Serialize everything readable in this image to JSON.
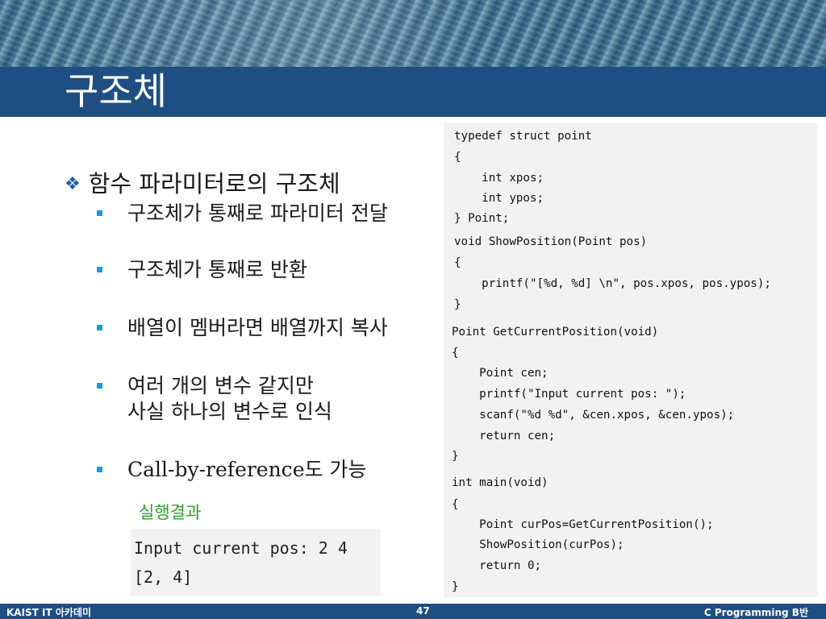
{
  "slide": {
    "title": "구조체",
    "heading": "함수 파라미터로의 구조체",
    "heading_bullet_icon": "diamond-cluster-icon",
    "bullets": [
      "구조체가 통째로 파라미터 전달",
      "구조체가 통째로 반환",
      "배열이 멤버라면 배열까지 복사",
      "여러 개의 변수 같지만",
      "사실 하나의 변수로 인식",
      "Call-by-reference도 가능"
    ],
    "result_label": "실행결과",
    "result_lines": [
      "Input current pos: 2 4",
      "[2, 4]"
    ]
  },
  "code": [
    "typedef struct point",
    "{",
    "    int xpos;",
    "    int ypos;",
    "} Point;",
    "void ShowPosition(Point pos)",
    "{",
    "    printf(\"[%d, %d] \\n\", pos.xpos, pos.ypos);",
    "}",
    "Point GetCurrentPosition(void)",
    "{",
    "    Point cen;",
    "    printf(\"Input current pos: \");",
    "    scanf(\"%d %d\", &cen.xpos, &cen.ypos);",
    "    return cen;",
    "}",
    "int main(void)",
    "{",
    "    Point curPos=GetCurrentPosition();",
    "    ShowPosition(curPos);",
    "    return 0;",
    "}"
  ],
  "footer": {
    "left": "KAIST IT 아카데미",
    "page": "47",
    "right": "C Programming B반"
  },
  "colors": {
    "title_bar": "#1f4e82",
    "bullet_square": "#1e9bd7",
    "result_label": "#2ca02c",
    "code_bg": "#f2f2f2"
  }
}
